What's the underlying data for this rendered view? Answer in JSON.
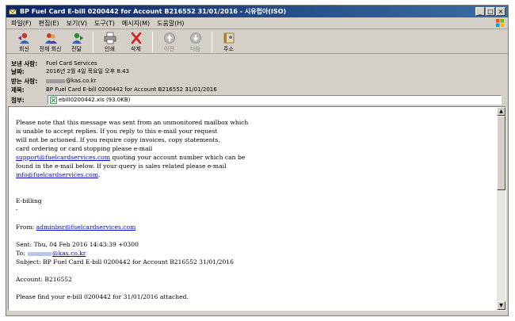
{
  "window": {
    "title": "BP Fuel Card E-bill 0200442 for Account B216552 31/01/2016 - 시유럽아(ISO)",
    "minimize": "_",
    "maximize": "□",
    "close": "×"
  },
  "menu": [
    "파일(F)",
    "편집(E)",
    "보기(V)",
    "도구(T)",
    "메시지(M)",
    "도움말(H)"
  ],
  "toolbar": {
    "reply": "회신",
    "reply_all": "전체 회신",
    "forward": "전달",
    "print": "인쇄",
    "delete": "삭제",
    "previous": "이전",
    "next": "다음",
    "addresses": "주소"
  },
  "header": {
    "from_label": "보낸 사람:",
    "from_value": "Fuel Card Services",
    "date_label": "날짜:",
    "date_value": "2016년 2월 4일 목요일 오후 8:43",
    "to_label": "받는 사람:",
    "to_value": "@kas.co.kr",
    "subject_label": "제목:",
    "subject_value": "BP Fuel Card E-bill 0200442 for Account B216552 31/01/2016",
    "attach_label": "첨부:",
    "attach_value": "ebill0200442.xls (93.0KB)"
  },
  "body": {
    "p1": [
      "Please note that this message was sent from an unmonitored mailbox which",
      "is unable to accept replies. If you reply to this e-mail your request",
      "will not be actioned. If you require copy invoices, copy statements,",
      "card ordering or card stopping please e-mail"
    ],
    "support_link": "support@fuelcardservices.com",
    "support_after": " quoting your account number which can be",
    "found_line": "found in the e-mail below. If your query is sales related please e-mail",
    "info_link": "info@fuelcardservices.com",
    "info_after": ".",
    "ebilling": "E-billing",
    "dash": "-",
    "from_prefix": "From: ",
    "from_link": "adminbsr@fuelcardservices.com",
    "sent": "Sent: Thu, 04 Feb 2016 14:43:39 +0300",
    "to_prefix": "To: ",
    "to_link": "@kas.co.kr",
    "subject": "Subject: BP Fuel Card E-bill 0200442 for Account B216552 31/01/2016",
    "account": "Account: B216552",
    "find": "Please find your e-bill 0200442 for 31/01/2016 attached."
  },
  "scrollbar": {
    "up": "▲",
    "down": "▼"
  },
  "colors": {
    "titlebar": "#0a246a",
    "link": "#0000cc",
    "chrome": "#d4d0c8"
  }
}
